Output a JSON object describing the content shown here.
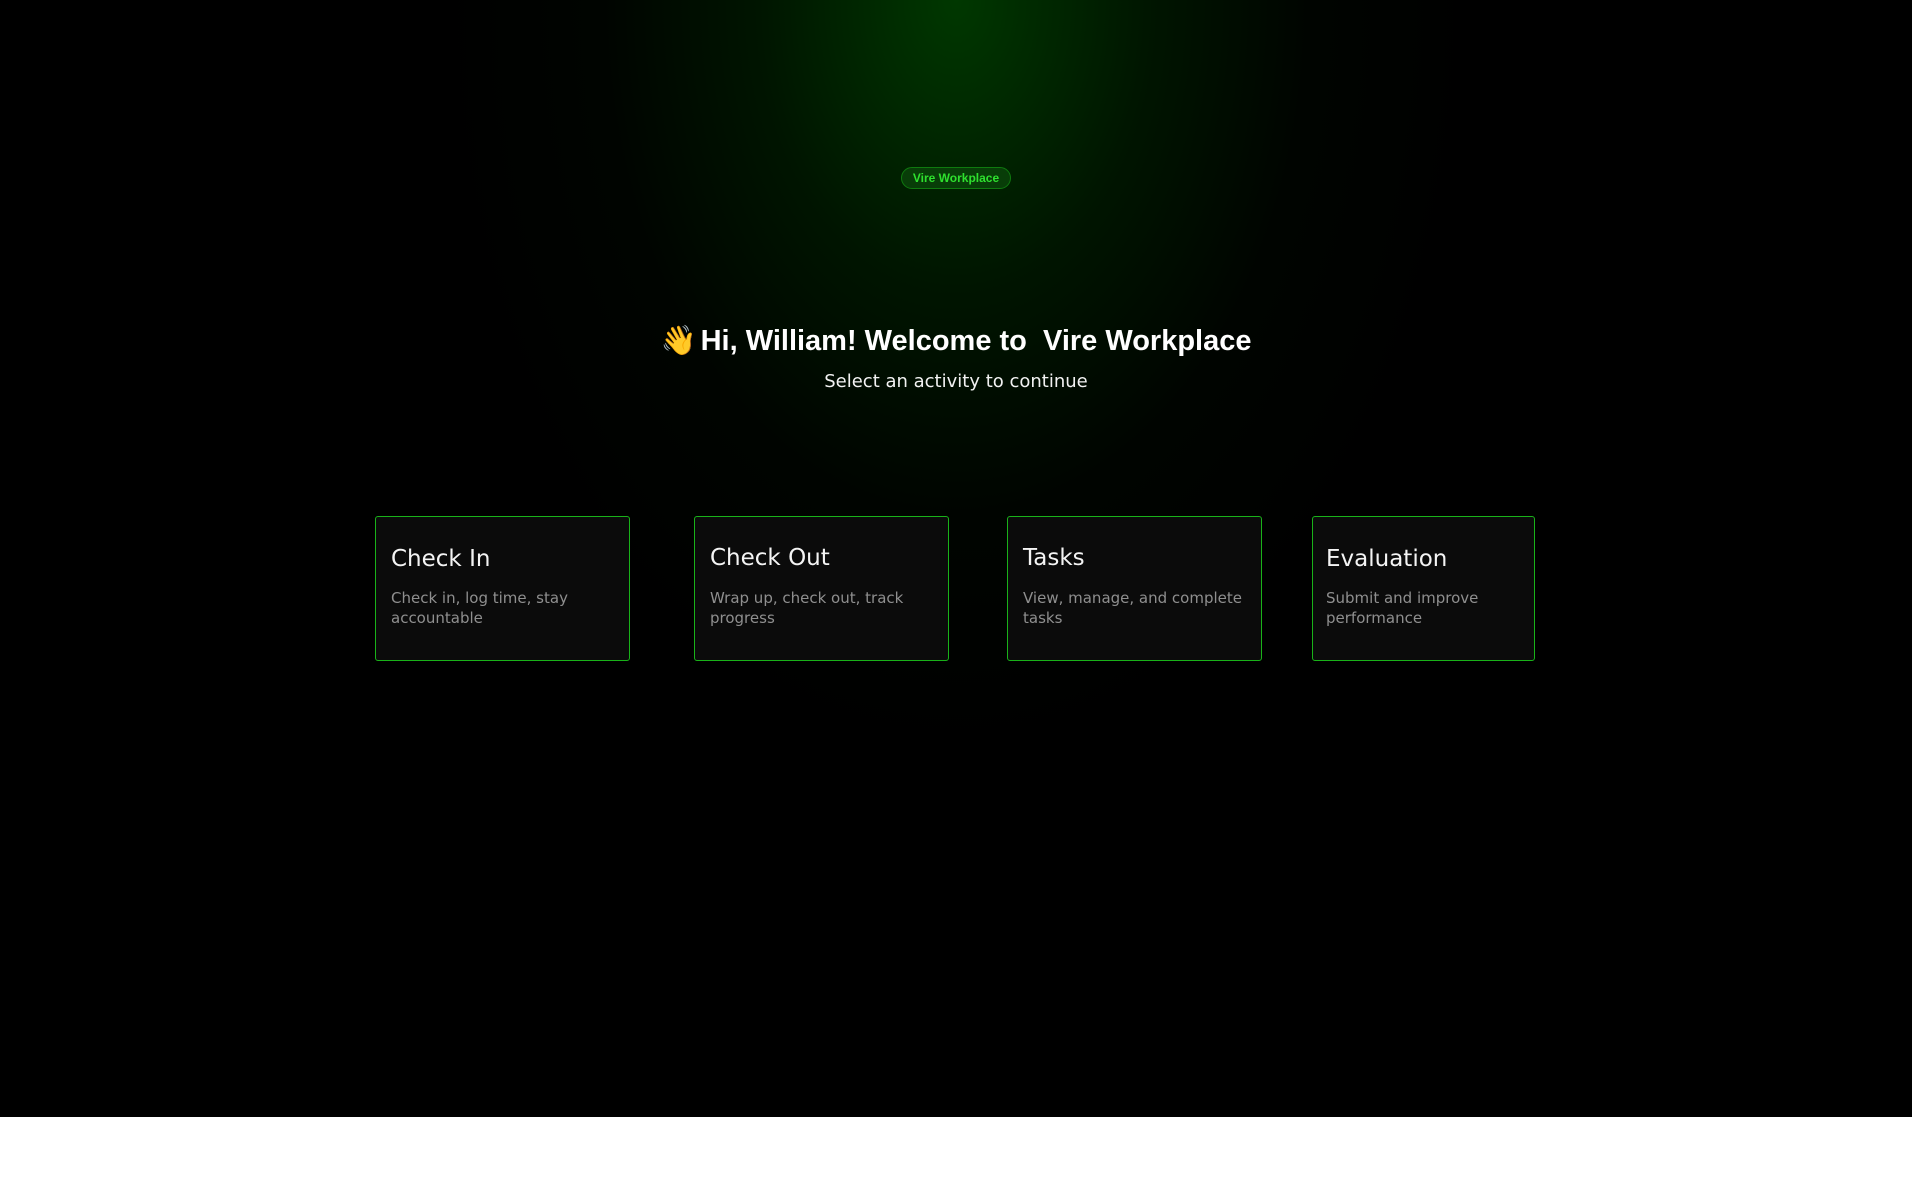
{
  "brand": {
    "badge_label": "Vire Workplace"
  },
  "header": {
    "wave_emoji": "👋",
    "greeting": "Hi, William! Welcome to  Vire Workplace",
    "subtitle": "Select an activity to continue"
  },
  "activities": [
    {
      "title": "Check In",
      "description": "Check in, log time, stay accountable"
    },
    {
      "title": "Check Out",
      "description": "Wrap up, check out, track progress"
    },
    {
      "title": "Tasks",
      "description": "View, manage, and complete tasks"
    },
    {
      "title": "Evaluation",
      "description": "Submit and improve performance"
    }
  ],
  "theme": {
    "accent": "#19b219",
    "background": "#000000",
    "card_background": "#0b0b0b",
    "badge_text": "#2ee02e"
  }
}
